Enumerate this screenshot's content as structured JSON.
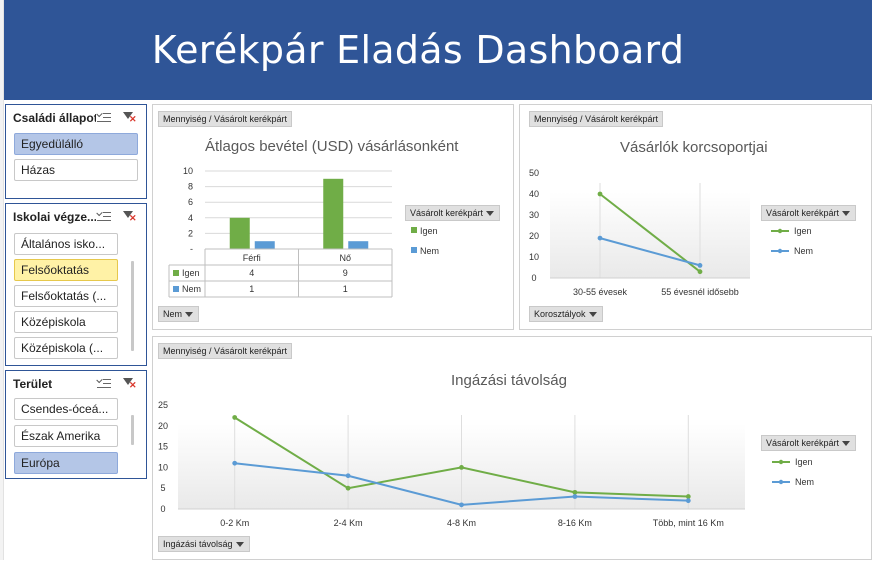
{
  "dashboard_title": "Kerékpár Eladás Dashboard",
  "colors": {
    "banner": "#2f5597",
    "igen": "#70ad47",
    "nem": "#5b9bd5",
    "selected": "#b4c6e7",
    "hover": "#fff2a6"
  },
  "icons": [
    "multi-select-icon",
    "clear-filter-icon",
    "dropdown-arrow-icon"
  ],
  "slicers": {
    "family": {
      "title": "Családi állapot",
      "items": [
        {
          "label": "Egyedülálló",
          "state": "selected"
        },
        {
          "label": "Házas",
          "state": "normal"
        }
      ]
    },
    "education": {
      "title": "Iskolai végze...",
      "items": [
        {
          "label": "Általános isko...",
          "state": "normal"
        },
        {
          "label": "Felsőoktatás",
          "state": "hover"
        },
        {
          "label": "Felsőoktatás (...",
          "state": "normal"
        },
        {
          "label": "Középiskola",
          "state": "normal"
        },
        {
          "label": "Középiskola (...",
          "state": "normal"
        }
      ]
    },
    "region": {
      "title": "Terület",
      "items": [
        {
          "label": "Csendes-óceá...",
          "state": "normal"
        },
        {
          "label": "Észak Amerika",
          "state": "normal"
        },
        {
          "label": "Európa",
          "state": "selected"
        }
      ]
    }
  },
  "charts": {
    "income": {
      "field_button": "Mennyiség / Vásárolt kerékpárt",
      "legend_button": "Vásárolt kerékpárt",
      "filter_button": "Nem",
      "title": "Átlagos bevétel (USD) vásárlásonként"
    },
    "age": {
      "field_button": "Mennyiség / Vásárolt kerékpárt",
      "legend_button": "Vásárolt kerékpárt",
      "filter_button": "Korosztályok",
      "title": "Vásárlók korcsoportjai"
    },
    "commute": {
      "field_button": "Mennyiség / Vásárolt kerékpárt",
      "legend_button": "Vásárolt kerékpárt",
      "filter_button": "Ingázási távolság",
      "title": "Ingázási távolság"
    }
  },
  "chart_data": [
    {
      "type": "bar",
      "title": "Átlagos bevétel (USD) vásárlásonként",
      "categories": [
        "Férfi",
        "Nő"
      ],
      "series": [
        {
          "name": "Igen",
          "values": [
            4,
            9
          ]
        },
        {
          "name": "Nem",
          "values": [
            1,
            1
          ]
        }
      ],
      "yticks": [
        "10",
        "8",
        "6",
        "4",
        "2",
        "-"
      ],
      "ylim": [
        0,
        10
      ],
      "data_table": true,
      "legend": "right",
      "grid": true
    },
    {
      "type": "line",
      "title": "Vásárlók korcsoportjai",
      "categories": [
        "30-55 évesek",
        "55 évesnél idősebb"
      ],
      "series": [
        {
          "name": "Igen",
          "values": [
            40,
            3
          ]
        },
        {
          "name": "Nem",
          "values": [
            19,
            6
          ]
        }
      ],
      "yticks": [
        "50",
        "40",
        "30",
        "20",
        "10",
        "0"
      ],
      "ylim": [
        0,
        50
      ],
      "legend": "right",
      "grid": false
    },
    {
      "type": "line",
      "title": "Ingázási távolság",
      "categories": [
        "0-2 Km",
        "2-4 Km",
        "4-8 Km",
        "8-16 Km",
        "Több, mint 16 Km"
      ],
      "series": [
        {
          "name": "Igen",
          "values": [
            22,
            5,
            10,
            4,
            3
          ]
        },
        {
          "name": "Nem",
          "values": [
            11,
            8,
            1,
            3,
            2
          ]
        }
      ],
      "yticks": [
        "25",
        "20",
        "15",
        "10",
        "5",
        "0"
      ],
      "ylim": [
        0,
        25
      ],
      "legend": "right",
      "grid": false
    }
  ]
}
